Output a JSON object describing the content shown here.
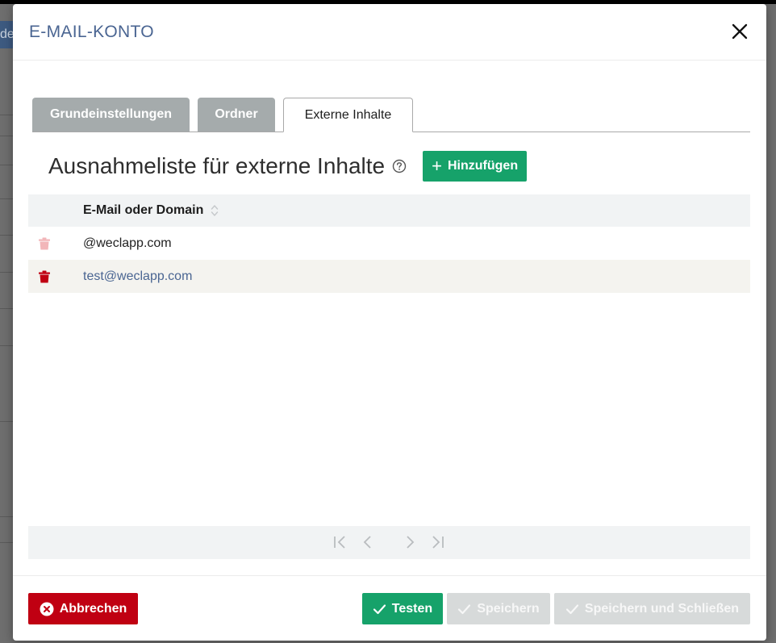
{
  "backdrop": {
    "button_fragment": "de"
  },
  "modal": {
    "title": "E-MAIL-KONTO",
    "close_icon": "close-icon"
  },
  "tabs": [
    {
      "label": "Grundeinstellungen",
      "active": false
    },
    {
      "label": "Ordner",
      "active": false
    },
    {
      "label": "Externe Inhalte",
      "active": true
    }
  ],
  "section": {
    "title": "Ausnahmeliste für externe Inhalte",
    "help_icon": "help-circle-icon",
    "add_button_label": "Hinzufügen"
  },
  "table": {
    "column_header": "E-Mail oder Domain",
    "rows": [
      {
        "value": "@weclapp.com",
        "delete_icon": "trash-icon",
        "delete_enabled": false
      },
      {
        "value": "test@weclapp.com",
        "delete_icon": "trash-icon",
        "delete_enabled": true
      }
    ]
  },
  "pager": {
    "first_icon": "first-page-icon",
    "prev_icon": "previous-page-icon",
    "next_icon": "next-page-icon",
    "last_icon": "last-page-icon"
  },
  "footer": {
    "cancel_label": "Abbrechen",
    "test_label": "Testen",
    "save_label": "Speichern",
    "save_close_label": "Speichern und Schließen"
  },
  "colors": {
    "primary_green": "#16a26a",
    "danger_red": "#c00012",
    "title_blue": "#4a6592",
    "disabled_gray": "#d7dada",
    "tab_gray": "#a5abac"
  }
}
